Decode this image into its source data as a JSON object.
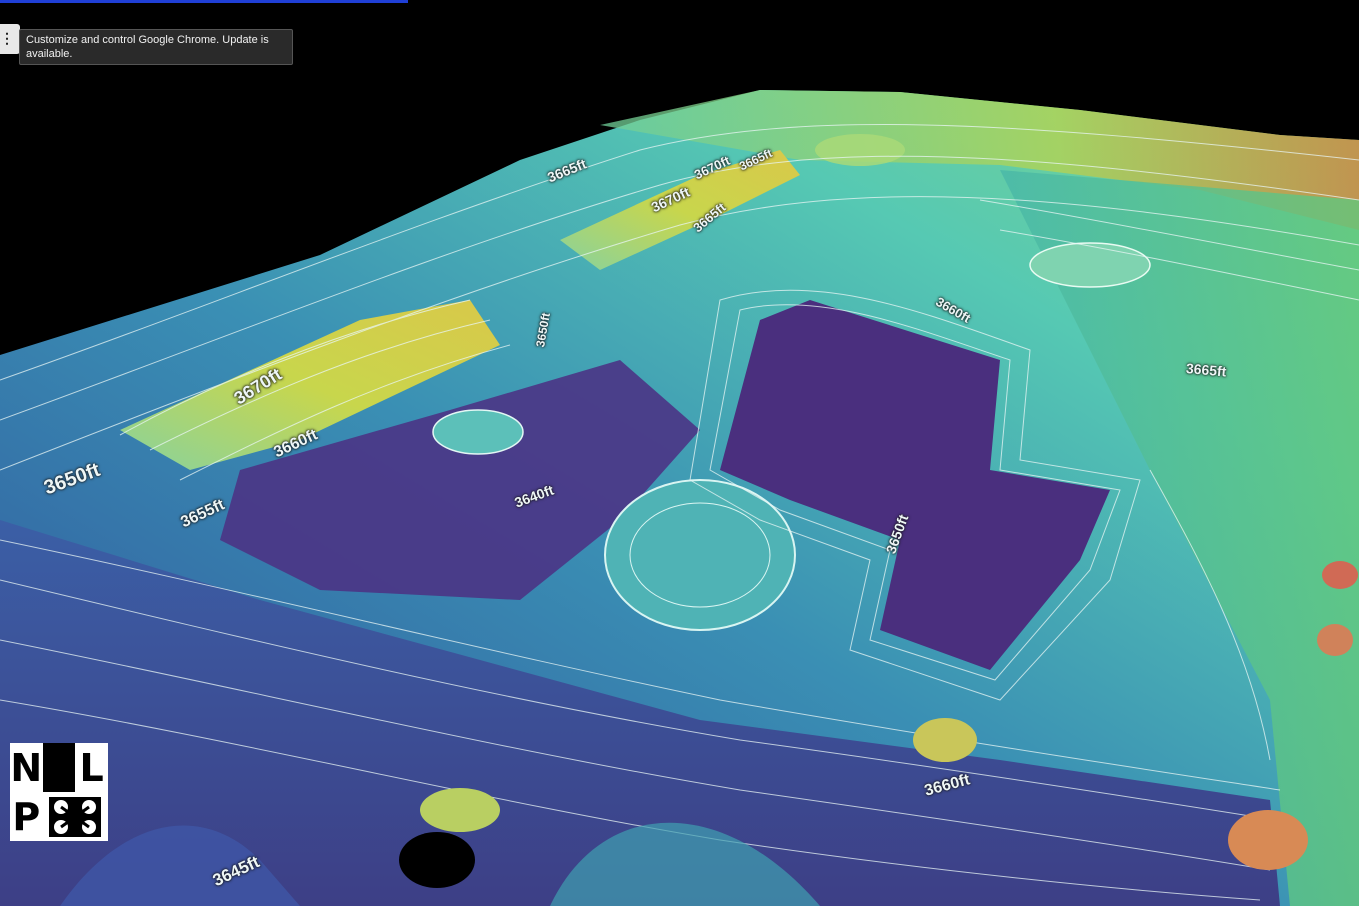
{
  "browser": {
    "tooltip": "Customize and control Google Chrome. Update is available.",
    "menu_icon": "chrome-menu-icon",
    "load_progress": 0.3
  },
  "map": {
    "contour_labels": [
      "3665ft",
      "3670ft",
      "3665ft",
      "3670ft",
      "3665ft",
      "3660ft",
      "3670ft",
      "3660ft",
      "3650ft",
      "3655ft",
      "3640ft",
      "3650ft",
      "3650ft",
      "3660ft",
      "3645ft",
      "3665ft"
    ],
    "colors": {
      "low": "#4b2d7f",
      "mid": "#3ea7b7",
      "high": "#c9d63c",
      "top": "#d98a3a"
    }
  },
  "logo": {
    "letters": [
      "N",
      "L",
      "P"
    ]
  }
}
